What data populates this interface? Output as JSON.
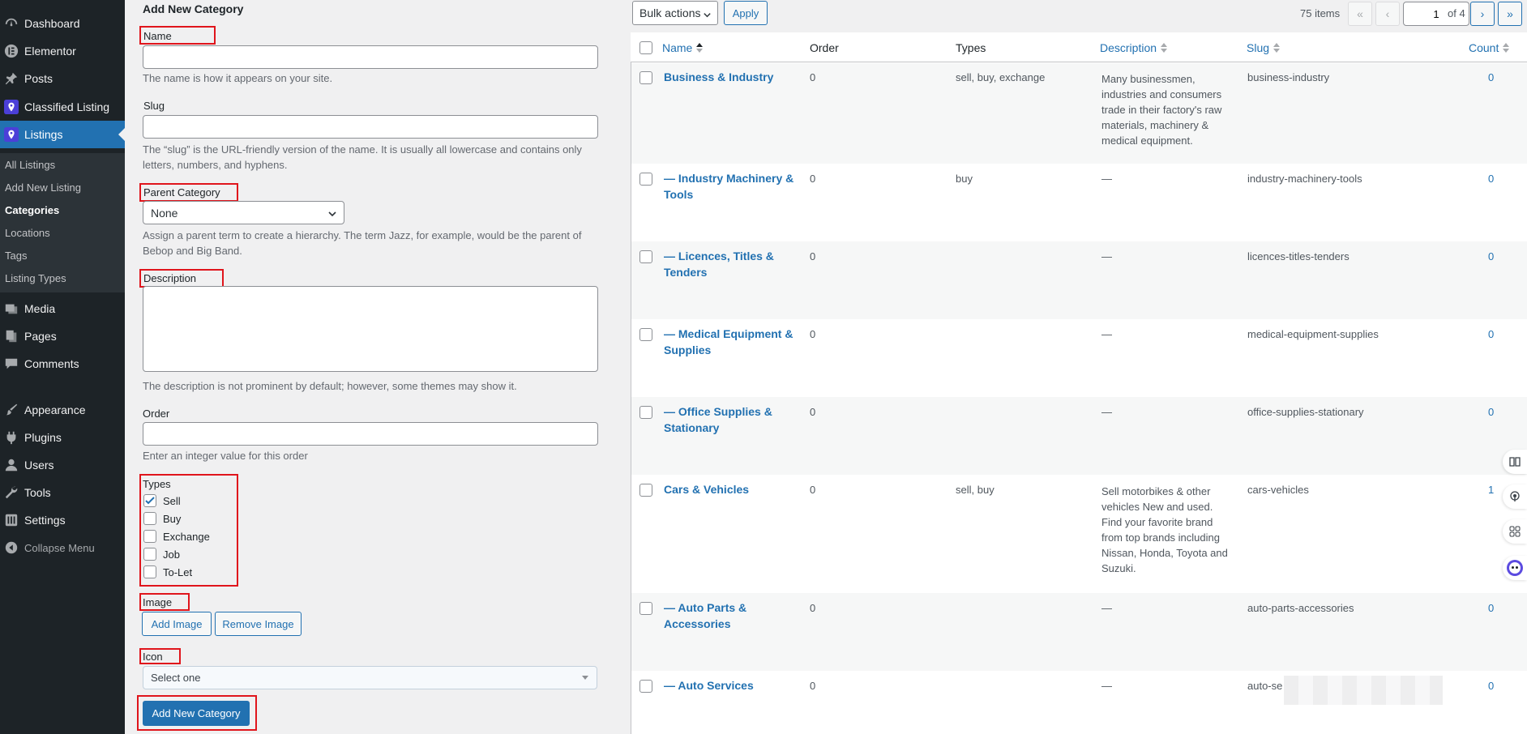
{
  "sidebar": {
    "items": [
      {
        "label": "Dashboard",
        "icon": "dashboard-icon"
      },
      {
        "label": "Elementor",
        "icon": "elementor-icon"
      },
      {
        "label": "Posts",
        "icon": "pin-icon"
      },
      {
        "label": "Classified Listing",
        "icon": "location-pin-icon"
      },
      {
        "label": "Listings",
        "icon": "location-pin-icon",
        "current": true
      },
      {
        "label": "Media",
        "icon": "media-icon"
      },
      {
        "label": "Pages",
        "icon": "pages-icon"
      },
      {
        "label": "Comments",
        "icon": "comment-icon"
      },
      {
        "label": "Appearance",
        "icon": "brush-icon"
      },
      {
        "label": "Plugins",
        "icon": "plug-icon"
      },
      {
        "label": "Users",
        "icon": "user-icon"
      },
      {
        "label": "Tools",
        "icon": "wrench-icon"
      },
      {
        "label": "Settings",
        "icon": "settings-sliders-icon"
      }
    ],
    "submenu": [
      "All Listings",
      "Add New Listing",
      "Categories",
      "Locations",
      "Tags",
      "Listing Types"
    ],
    "collapse_label": "Collapse Menu"
  },
  "form": {
    "heading": "Add New Category",
    "name_label": "Name",
    "name_value": "",
    "name_hint": "The name is how it appears on your site.",
    "slug_label": "Slug",
    "slug_value": "",
    "slug_hint_1": "The “slug” is the URL-friendly version of the name. It is usually all lowercase and contains only",
    "slug_hint_2": "letters, numbers, and hyphens.",
    "parent_label": "Parent Category",
    "parent_value": "None",
    "parent_hint_1": "Assign a parent term to create a hierarchy. The term Jazz, for example, would be the parent of",
    "parent_hint_2": "Bebop and Big Band.",
    "description_label": "Description",
    "description_hint": "The description is not prominent by default; however, some themes may show it.",
    "order_label": "Order",
    "order_hint": "Enter an integer value for this order",
    "types_label": "Types",
    "types": [
      {
        "label": "Sell",
        "checked": true
      },
      {
        "label": "Buy",
        "checked": false
      },
      {
        "label": "Exchange",
        "checked": false
      },
      {
        "label": "Job",
        "checked": false
      },
      {
        "label": "To-Let",
        "checked": false
      }
    ],
    "image_label": "Image",
    "add_image": "Add Image",
    "remove_image": "Remove Image",
    "icon_label": "Icon",
    "icon_value": "Select one",
    "submit": "Add New Category"
  },
  "toolbar": {
    "bulk_actions": "Bulk actions",
    "apply": "Apply",
    "items_count": "75 items",
    "first": "«",
    "prev": "‹",
    "page_value": "1",
    "of_pages": "of 4",
    "next": "›",
    "last": "»"
  },
  "table": {
    "headers": {
      "name": "Name",
      "order": "Order",
      "types": "Types",
      "description": "Description",
      "slug": "Slug",
      "count": "Count"
    },
    "rows": [
      {
        "name_1": "Business & Industry",
        "name_2": "",
        "order": "0",
        "types": "sell, buy, exchange",
        "desc": [
          "Many businessmen,",
          "industries and consumers",
          "trade in their factory's raw",
          "materials, machinery &",
          "medical equipment."
        ],
        "slug": "business-industry",
        "count": "0"
      },
      {
        "name_1": "— Industry Machinery &",
        "name_2": "Tools",
        "order": "0",
        "types": "buy",
        "desc": [
          "—"
        ],
        "slug": "industry-machinery-tools",
        "count": "0"
      },
      {
        "name_1": "— Licences, Titles &",
        "name_2": "Tenders",
        "order": "0",
        "types": "",
        "desc": [
          "—"
        ],
        "slug": "licences-titles-tenders",
        "count": "0"
      },
      {
        "name_1": "— Medical Equipment &",
        "name_2": "Supplies",
        "order": "0",
        "types": "",
        "desc": [
          "—"
        ],
        "slug": "medical-equipment-supplies",
        "count": "0"
      },
      {
        "name_1": "— Office Supplies &",
        "name_2": "Stationary",
        "order": "0",
        "types": "",
        "desc": [
          "—"
        ],
        "slug": "office-supplies-stationary",
        "count": "0"
      },
      {
        "name_1": "Cars & Vehicles",
        "name_2": "",
        "order": "0",
        "types": "sell, buy",
        "desc": [
          "Sell motorbikes & other",
          "vehicles New and used.",
          "Find your favorite brand",
          "from top brands including",
          "Nissan, Honda, Toyota and",
          "Suzuki."
        ],
        "slug": "cars-vehicles",
        "count": "1"
      },
      {
        "name_1": "— Auto Parts &",
        "name_2": "Accessories",
        "order": "0",
        "types": "",
        "desc": [
          "—"
        ],
        "slug": "auto-parts-accessories",
        "count": "0"
      },
      {
        "name_1": "— Auto Services",
        "name_2": "",
        "order": "0",
        "types": "",
        "desc": [
          "—"
        ],
        "slug": "auto-se",
        "count": "0"
      }
    ]
  }
}
